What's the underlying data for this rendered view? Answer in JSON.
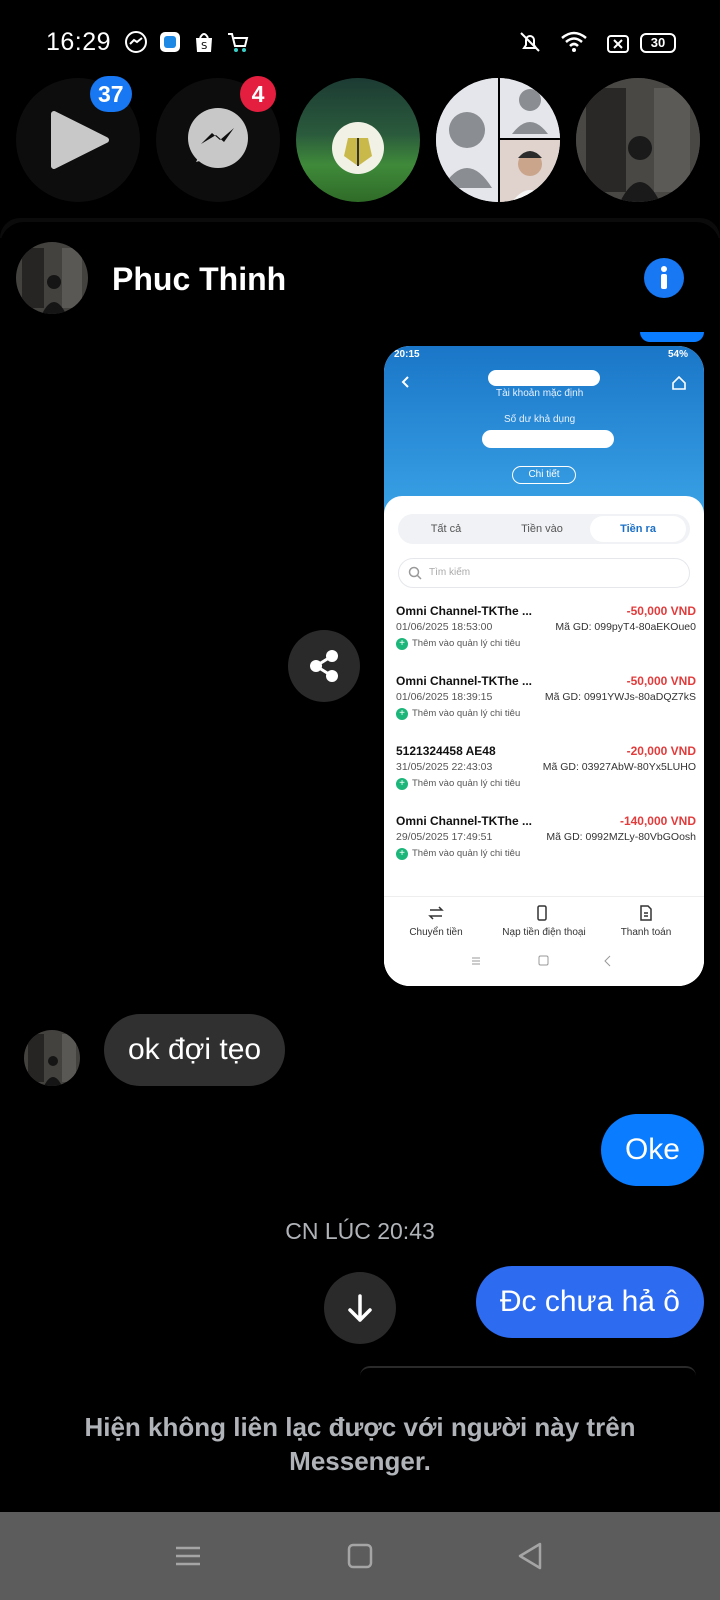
{
  "status_bar": {
    "time": "16:29",
    "battery": "30"
  },
  "chat_heads": [
    {
      "kind": "video",
      "badge": "37",
      "badge_color": "#1877f2"
    },
    {
      "kind": "messenger",
      "badge": "4",
      "badge_color": "#e41e3f"
    },
    {
      "kind": "photo-football"
    },
    {
      "kind": "group"
    },
    {
      "kind": "photo-person"
    }
  ],
  "header": {
    "name": "Phuc Thinh"
  },
  "shared_image": {
    "status_time": "20:15",
    "status_battery": "54%",
    "top_label_1": "Tài khoản mặc định",
    "top_label_2": "Số dư khả dụng",
    "detail_button": "Chi tiết",
    "tabs": [
      "Tất cả",
      "Tiền vào",
      "Tiền ra"
    ],
    "active_tab": "Tiền ra",
    "search_placeholder": "Tìm kiếm",
    "transactions": [
      {
        "name": "Omni Channel-TKThe ...",
        "amount": "-50,000 VND",
        "date": "01/06/2025 18:53:00",
        "code": "Mã GD: 099pyT4-80aEKOue0",
        "action": "Thêm vào quản lý chi tiêu"
      },
      {
        "name": "Omni Channel-TKThe ...",
        "amount": "-50,000 VND",
        "date": "01/06/2025 18:39:15",
        "code": "Mã GD: 0991YWJs-80aDQZ7kS",
        "action": "Thêm vào quản lý chi tiêu"
      },
      {
        "name": "5121324458 AE48",
        "amount": "-20,000 VND",
        "date": "31/05/2025 22:43:03",
        "code": "Mã GD: 03927AbW-80Yx5LUHO",
        "action": "Thêm vào quản lý chi tiêu"
      },
      {
        "name": "Omni Channel-TKThe ...",
        "amount": "-140,000 VND",
        "date": "29/05/2025 17:49:51",
        "code": "Mã GD: 0992MZLy-80VbGOosh",
        "action": "Thêm vào quản lý chi tiêu"
      }
    ],
    "bottom_nav": [
      "Chuyển tiền",
      "Nạp tiền điện thoại",
      "Thanh toán"
    ]
  },
  "messages": [
    {
      "from": "them",
      "text": "ok đợi tẹo"
    },
    {
      "from": "me",
      "text": "Oke"
    },
    {
      "from": "me",
      "text": "Đc chưa hả ô"
    }
  ],
  "timestamp": "CN LÚC 20:43",
  "notice_line1": "Hiện không liên lạc được với người này trên",
  "notice_line2": "Messenger.",
  "colors": {
    "accent": "#0a7cff",
    "incoming": "#303030",
    "background": "#000000"
  }
}
